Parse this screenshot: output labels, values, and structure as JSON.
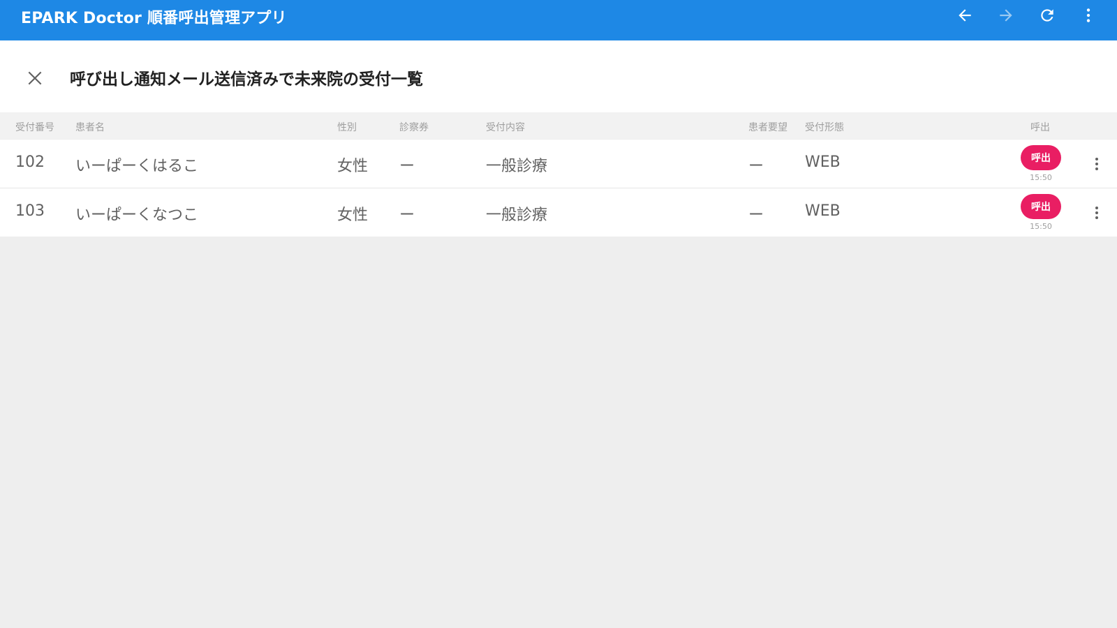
{
  "app_bar": {
    "title": "EPARK Doctor 順番呼出管理アプリ",
    "color": "#1e88e5",
    "actions": [
      {
        "name": "back",
        "icon": "arrow-left-icon"
      },
      {
        "name": "forward",
        "icon": "arrow-right-icon"
      },
      {
        "name": "reload",
        "icon": "refresh-icon"
      },
      {
        "name": "menu",
        "icon": "more-vertical-icon"
      }
    ]
  },
  "panel": {
    "close_icon": "close-icon",
    "title": "呼び出し通知メール送信済みで未来院の受付一覧"
  },
  "table": {
    "headers": {
      "number": "受付番号",
      "name": "患者名",
      "gender": "性別",
      "ticket": "診察券",
      "content": "受付内容",
      "request": "患者要望",
      "type": "受付形態",
      "call": "呼出"
    },
    "rows": [
      {
        "number": "102",
        "name": "いーぱーくはるこ",
        "gender": "女性",
        "ticket": "ー",
        "content": "一般診療",
        "request": "ー",
        "type": "WEB",
        "call_label": "呼出",
        "call_time": "15:50"
      },
      {
        "number": "103",
        "name": "いーぱーくなつこ",
        "gender": "女性",
        "ticket": "ー",
        "content": "一般診療",
        "request": "ー",
        "type": "WEB",
        "call_label": "呼出",
        "call_time": "15:50"
      }
    ]
  },
  "colors": {
    "accent": "#1e88e5",
    "call_button": "#e91e63"
  }
}
